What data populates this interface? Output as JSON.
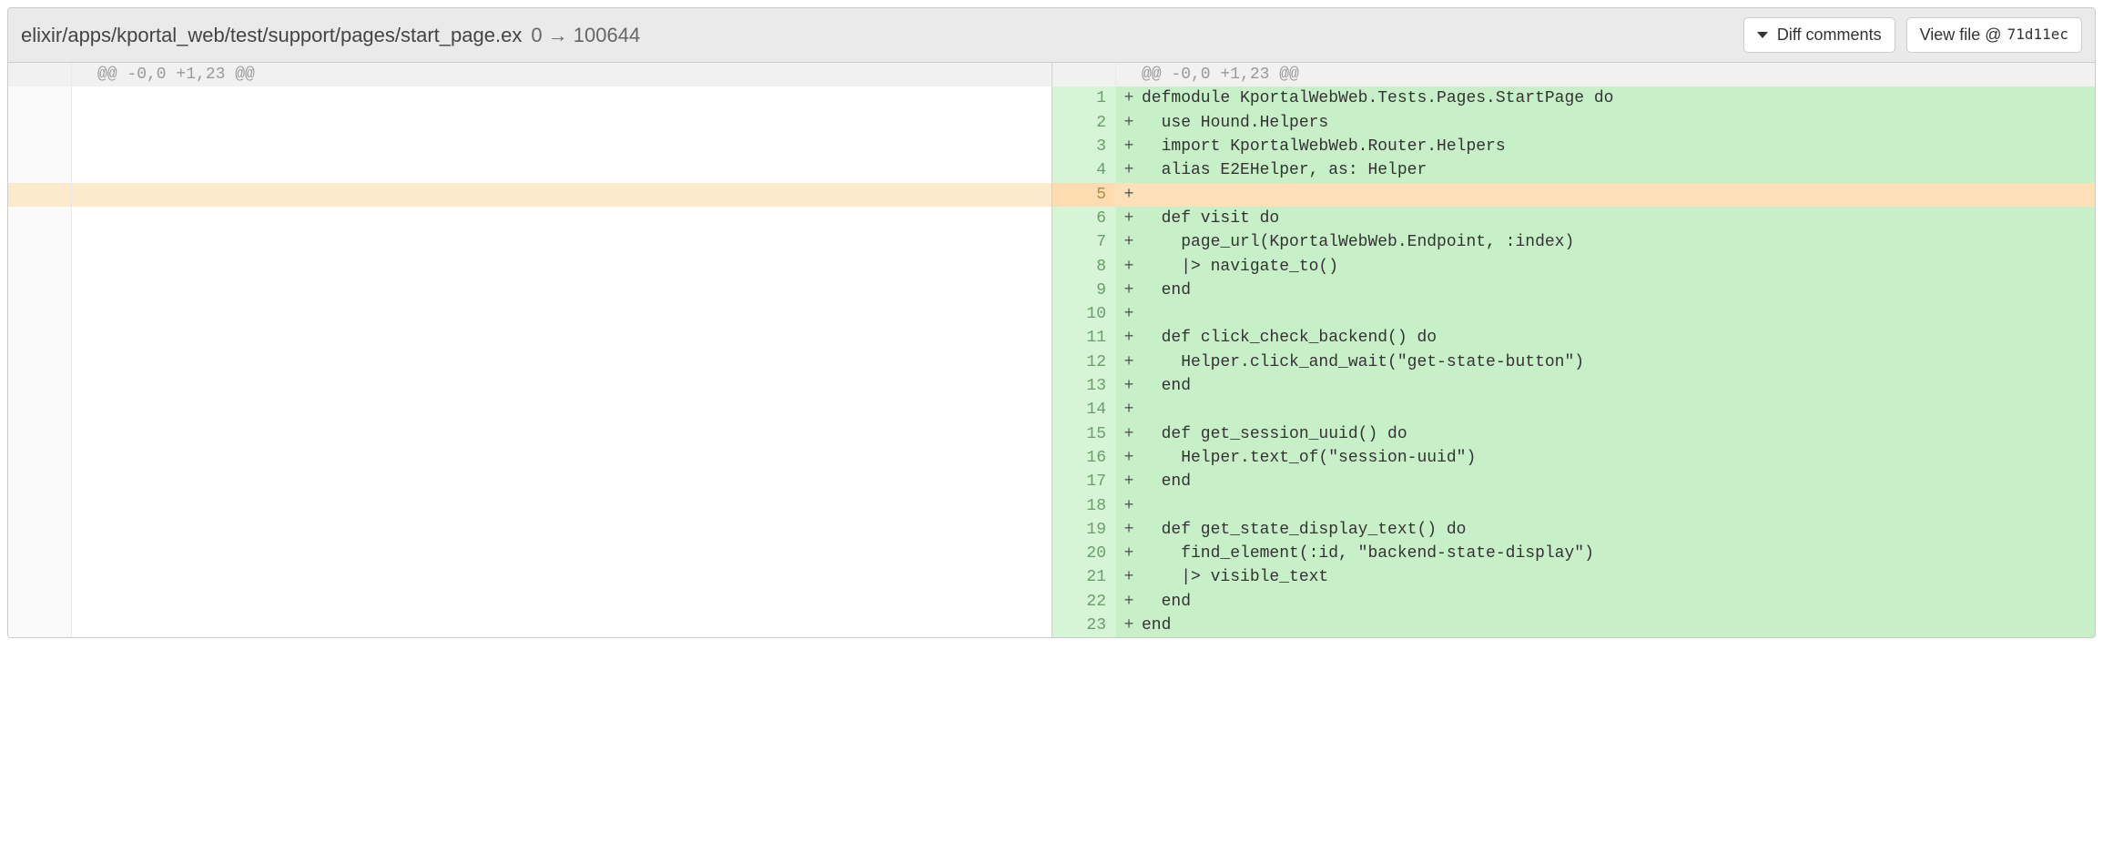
{
  "header": {
    "file_path": "elixir/apps/kportal_web/test/support/pages/start_page.ex",
    "mode_change": "0 → 100644",
    "diff_comments_label": "Diff comments",
    "view_file_label": "View file @",
    "commit_hash": "71d11ec"
  },
  "hunk_header": "@@ -0,0 +1,23 @@",
  "lines": [
    {
      "n": 1,
      "mark": "+",
      "text": "defmodule KportalWebWeb.Tests.Pages.StartPage do",
      "hl": false
    },
    {
      "n": 2,
      "mark": "+",
      "text": "  use Hound.Helpers",
      "hl": false
    },
    {
      "n": 3,
      "mark": "+",
      "text": "  import KportalWebWeb.Router.Helpers",
      "hl": false
    },
    {
      "n": 4,
      "mark": "+",
      "text": "  alias E2EHelper, as: Helper",
      "hl": false
    },
    {
      "n": 5,
      "mark": "+",
      "text": "",
      "hl": true
    },
    {
      "n": 6,
      "mark": "+",
      "text": "  def visit do",
      "hl": false
    },
    {
      "n": 7,
      "mark": "+",
      "text": "    page_url(KportalWebWeb.Endpoint, :index)",
      "hl": false
    },
    {
      "n": 8,
      "mark": "+",
      "text": "    |> navigate_to()",
      "hl": false
    },
    {
      "n": 9,
      "mark": "+",
      "text": "  end",
      "hl": false
    },
    {
      "n": 10,
      "mark": "+",
      "text": "",
      "hl": false
    },
    {
      "n": 11,
      "mark": "+",
      "text": "  def click_check_backend() do",
      "hl": false
    },
    {
      "n": 12,
      "mark": "+",
      "text": "    Helper.click_and_wait(\"get-state-button\")",
      "hl": false
    },
    {
      "n": 13,
      "mark": "+",
      "text": "  end",
      "hl": false
    },
    {
      "n": 14,
      "mark": "+",
      "text": "",
      "hl": false
    },
    {
      "n": 15,
      "mark": "+",
      "text": "  def get_session_uuid() do",
      "hl": false
    },
    {
      "n": 16,
      "mark": "+",
      "text": "    Helper.text_of(\"session-uuid\")",
      "hl": false
    },
    {
      "n": 17,
      "mark": "+",
      "text": "  end",
      "hl": false
    },
    {
      "n": 18,
      "mark": "+",
      "text": "",
      "hl": false
    },
    {
      "n": 19,
      "mark": "+",
      "text": "  def get_state_display_text() do",
      "hl": false
    },
    {
      "n": 20,
      "mark": "+",
      "text": "    find_element(:id, \"backend-state-display\")",
      "hl": false
    },
    {
      "n": 21,
      "mark": "+",
      "text": "    |> visible_text",
      "hl": false
    },
    {
      "n": 22,
      "mark": "+",
      "text": "  end",
      "hl": false
    },
    {
      "n": 23,
      "mark": "+",
      "text": "end",
      "hl": false
    }
  ]
}
